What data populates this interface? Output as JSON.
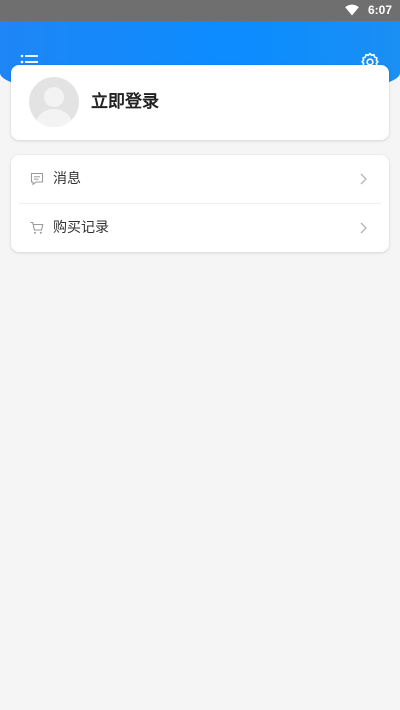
{
  "status_bar": {
    "time": "6:07",
    "wifi_icon": "wifi-icon"
  },
  "header": {
    "menu_icon": "list-menu-icon",
    "settings_icon": "gear-icon",
    "accent_color": "#0b8cff"
  },
  "profile": {
    "avatar_icon": "default-avatar-icon",
    "login_label": "立即登录"
  },
  "menu": {
    "items": [
      {
        "label": "消息",
        "icon": "message-icon"
      },
      {
        "label": "购买记录",
        "icon": "cart-icon"
      }
    ],
    "chevron_icon": "chevron-right-icon"
  }
}
